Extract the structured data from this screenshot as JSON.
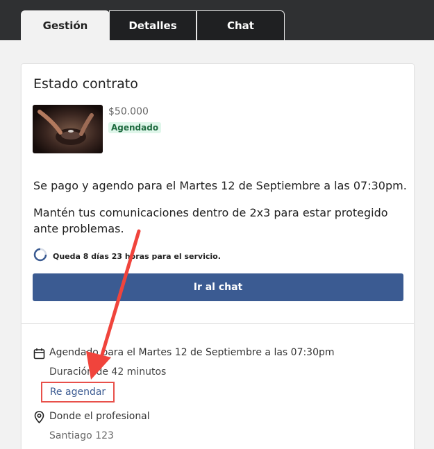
{
  "tabs": [
    {
      "label": "Gestión"
    },
    {
      "label": "Detalles"
    },
    {
      "label": "Chat"
    }
  ],
  "card": {
    "title": "Estado contrato",
    "price": "$50.000",
    "status_badge": "Agendado",
    "paragraph_1": "Se pago y agendo para el Martes 12 de Septiembre a las 07:30pm.",
    "paragraph_2": "Mantén tus comunicaciones dentro de 2x3 para estar protegido ante problemas.",
    "timer_text": "Queda 8 días 23 horas para el servicio.",
    "chat_button": "Ir al chat",
    "scheduled_text": "Agendado para el Martes 12 de Septiembre a las 07:30pm",
    "duration_text": "Duración de 42 minutos",
    "reschedule_button": "Re agendar",
    "location_label": "Donde el profesional",
    "address": "Santiago 123"
  },
  "icons": [
    "calendar-icon",
    "location-pin-icon",
    "timer-ring-icon"
  ],
  "colors": {
    "topbar": "#2f3032",
    "primary_button": "#3b5b92",
    "badge_bg": "#dff6ea",
    "badge_text": "#1f6b40",
    "annotation": "#e8504a"
  }
}
